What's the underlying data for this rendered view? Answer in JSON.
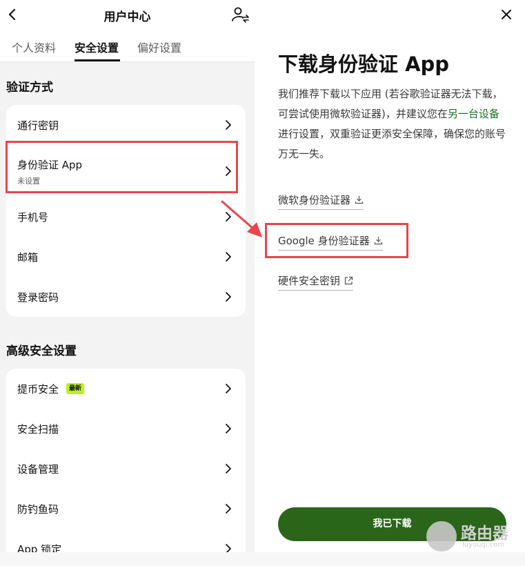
{
  "left": {
    "title": "用户中心",
    "tabs": [
      "个人资料",
      "安全设置",
      "偏好设置"
    ],
    "active_tab": "安全设置",
    "section_verify": "验证方式",
    "verify_items": [
      {
        "label": "通行密钥"
      },
      {
        "label": "身份验证 App",
        "sub": "未设置"
      },
      {
        "label": "手机号"
      },
      {
        "label": "邮箱"
      },
      {
        "label": "登录密码"
      }
    ],
    "section_advanced": "高级安全设置",
    "advanced_items": [
      {
        "label": "提币安全",
        "badge": "最新"
      },
      {
        "label": "安全扫描"
      },
      {
        "label": "设备管理"
      },
      {
        "label": "防钓鱼码"
      },
      {
        "label": "App 锁定"
      }
    ]
  },
  "right": {
    "title": "下载身份验证 App",
    "desc_part1": "我们推荐下载以下应用 (若谷歌验证器无法下载，可尝试使用微软验证器)，并建议您在",
    "desc_link": "另一台设备",
    "desc_part2": "进行设置，双重验证更添安全保障，确保您的账号万无一失。",
    "links": [
      {
        "label": "微软身份验证器",
        "icon": "download-icon"
      },
      {
        "label": "Google 身份验证器",
        "icon": "download-icon"
      },
      {
        "label": "硬件安全密钥",
        "icon": "external-link-icon"
      }
    ],
    "button": "我已下载"
  },
  "watermark": {
    "text": "路由器",
    "url": "luyouqi.com"
  },
  "colors": {
    "accent_green": "#2b6519",
    "highlight_red": "#e8454d",
    "badge_lime": "#b9f21b"
  }
}
